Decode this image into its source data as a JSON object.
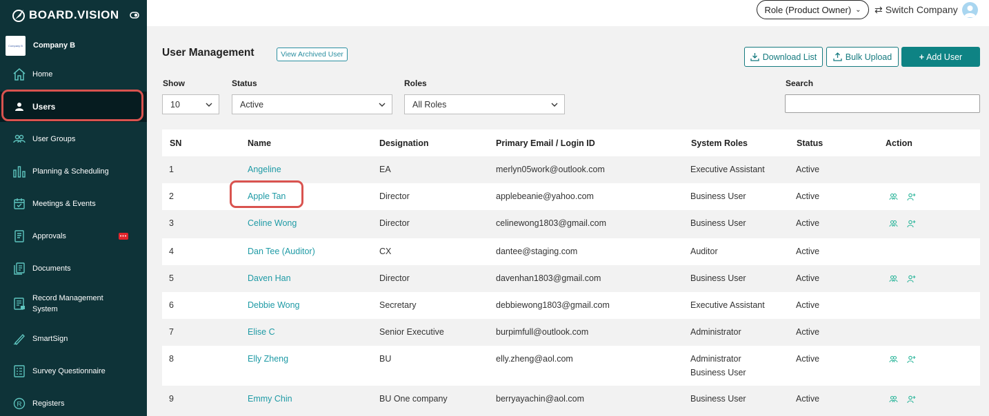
{
  "app": {
    "logo_text": "BOARD.VISION"
  },
  "company": {
    "name": "Company B",
    "logo_text": "Company B"
  },
  "sidebar": {
    "items": [
      {
        "label": "Home",
        "icon": "home-icon"
      },
      {
        "label": "Users",
        "icon": "user-icon",
        "active": true
      },
      {
        "label": "User Groups",
        "icon": "user-groups-icon"
      },
      {
        "label": "Planning & Scheduling",
        "icon": "planning-icon"
      },
      {
        "label": "Meetings & Events",
        "icon": "calendar-icon"
      },
      {
        "label": "Approvals",
        "icon": "approvals-icon",
        "badge": "•••"
      },
      {
        "label": "Documents",
        "icon": "documents-icon"
      },
      {
        "label": "Record Management System",
        "icon": "record-icon"
      },
      {
        "label": "SmartSign",
        "icon": "pen-icon"
      },
      {
        "label": "Survey Questionnaire",
        "icon": "survey-icon"
      },
      {
        "label": "Registers",
        "icon": "registered-icon"
      }
    ]
  },
  "topbar": {
    "role": "Role (Product Owner)",
    "switch_company": "Switch Company"
  },
  "page": {
    "title": "User Management",
    "view_archived": "View Archived User",
    "download": "Download List",
    "bulk_upload": "Bulk Upload",
    "add_user": "Add User"
  },
  "filters": {
    "show_label": "Show",
    "show_value": "10",
    "status_label": "Status",
    "status_value": "Active",
    "roles_label": "Roles",
    "roles_value": "All Roles",
    "search_label": "Search",
    "search_value": ""
  },
  "table": {
    "headers": [
      "SN",
      "Name",
      "Designation",
      "Primary Email / Login ID",
      "System Roles",
      "Status",
      "Action"
    ],
    "rows": [
      {
        "sn": "1",
        "name": "Angeline",
        "designation": "EA",
        "email": "merlyn05work@outlook.com",
        "roles": [
          "Executive Assistant"
        ],
        "status": "Active",
        "actions": false
      },
      {
        "sn": "2",
        "name": "Apple Tan",
        "designation": "Director",
        "email": "applebeanie@yahoo.com",
        "roles": [
          "Business User"
        ],
        "status": "Active",
        "actions": true
      },
      {
        "sn": "3",
        "name": "Celine Wong",
        "designation": "Director",
        "email": "celinewong1803@gmail.com",
        "roles": [
          "Business User"
        ],
        "status": "Active",
        "actions": true
      },
      {
        "sn": "4",
        "name": "Dan Tee (Auditor)",
        "designation": "CX",
        "email": "dantee@staging.com",
        "roles": [
          "Auditor"
        ],
        "status": "Active",
        "actions": false
      },
      {
        "sn": "5",
        "name": "Daven Han",
        "designation": "Director",
        "email": "davenhan1803@gmail.com",
        "roles": [
          "Business User"
        ],
        "status": "Active",
        "actions": true
      },
      {
        "sn": "6",
        "name": "Debbie Wong",
        "designation": "Secretary",
        "email": "debbiewong1803@gmail.com",
        "roles": [
          "Executive Assistant"
        ],
        "status": "Active",
        "actions": false
      },
      {
        "sn": "7",
        "name": "Elise C",
        "designation": "Senior Executive",
        "email": "burpimfull@outlook.com",
        "roles": [
          "Administrator"
        ],
        "status": "Active",
        "actions": false
      },
      {
        "sn": "8",
        "name": "Elly Zheng",
        "designation": "BU",
        "email": "elly.zheng@aol.com",
        "roles": [
          "Administrator",
          "Business User"
        ],
        "status": "Active",
        "actions": true
      },
      {
        "sn": "9",
        "name": "Emmy Chin",
        "designation": "BU One company",
        "email": "berryayachin@aol.com",
        "roles": [
          "Business User"
        ],
        "status": "Active",
        "actions": true
      }
    ]
  },
  "colors": {
    "sidebar_bg": "#0e3338",
    "accent": "#0e8384",
    "link": "#1e9aa5",
    "highlight": "#d9534f"
  }
}
